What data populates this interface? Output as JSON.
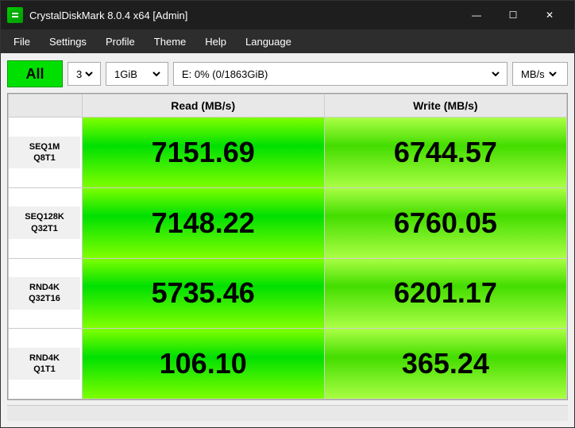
{
  "window": {
    "title": "CrystalDiskMark 8.0.4 x64 [Admin]",
    "icon_label": "CDM"
  },
  "window_controls": {
    "minimize": "—",
    "maximize": "☐",
    "close": "✕"
  },
  "menu": {
    "items": [
      {
        "label": "File",
        "id": "file"
      },
      {
        "label": "Settings",
        "id": "settings"
      },
      {
        "label": "Profile",
        "id": "profile"
      },
      {
        "label": "Theme",
        "id": "theme"
      },
      {
        "label": "Help",
        "id": "help"
      },
      {
        "label": "Language",
        "id": "language"
      }
    ]
  },
  "toolbar": {
    "all_button": "All",
    "loops": "3",
    "size": "1GiB",
    "drive": "E: 0% (0/1863GiB)",
    "unit": "MB/s"
  },
  "table": {
    "headers": {
      "label": "",
      "read": "Read (MB/s)",
      "write": "Write (MB/s)"
    },
    "rows": [
      {
        "label_line1": "SEQ1M",
        "label_line2": "Q8T1",
        "read": "7151.69",
        "write": "6744.57"
      },
      {
        "label_line1": "SEQ128K",
        "label_line2": "Q32T1",
        "read": "7148.22",
        "write": "6760.05"
      },
      {
        "label_line1": "RND4K",
        "label_line2": "Q32T16",
        "read": "5735.46",
        "write": "6201.17"
      },
      {
        "label_line1": "RND4K",
        "label_line2": "Q1T1",
        "read": "106.10",
        "write": "365.24"
      }
    ]
  },
  "colors": {
    "title_bar_bg": "#1e1e1e",
    "menu_bar_bg": "#2d2d2d",
    "content_bg": "#f0f0f0",
    "all_btn_bg": "#00e000",
    "read_cell_bg": "#55ee00",
    "write_cell_bg": "#88ee44",
    "accent_green": "#00cc00"
  }
}
